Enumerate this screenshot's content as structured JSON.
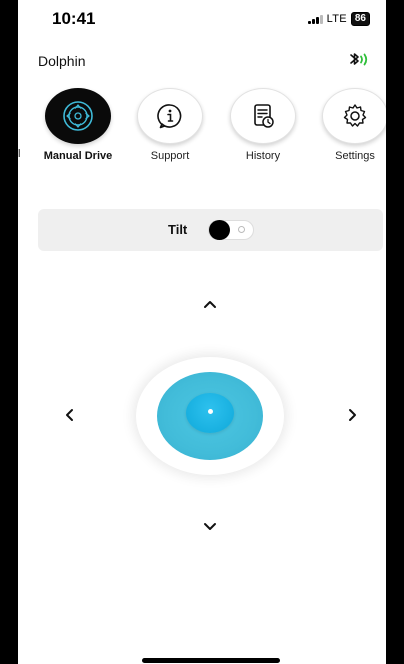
{
  "status": {
    "time": "10:41",
    "network": "LTE",
    "battery": "86"
  },
  "app": {
    "name": "Dolphin",
    "bluetooth_icon": "bluetooth-connected-icon"
  },
  "nav": {
    "partial_label": "l",
    "items": [
      {
        "label": "Manual Drive",
        "icon": "gamepad-icon",
        "active": true
      },
      {
        "label": "Support",
        "icon": "info-icon",
        "active": false
      },
      {
        "label": "History",
        "icon": "history-icon",
        "active": false
      },
      {
        "label": "Settings",
        "icon": "gear-icon",
        "active": false
      }
    ]
  },
  "tilt": {
    "label": "Tilt",
    "enabled": false
  },
  "joystick": {
    "up_icon": "chevron-up-icon",
    "down_icon": "chevron-down-icon",
    "left_icon": "chevron-left-icon",
    "right_icon": "chevron-right-icon"
  },
  "colors": {
    "accent": "#3fbad8",
    "knob": "#1ab1e1",
    "active_nav": "#0a0a0a",
    "bluetooth_green": "#2fbf3a"
  }
}
